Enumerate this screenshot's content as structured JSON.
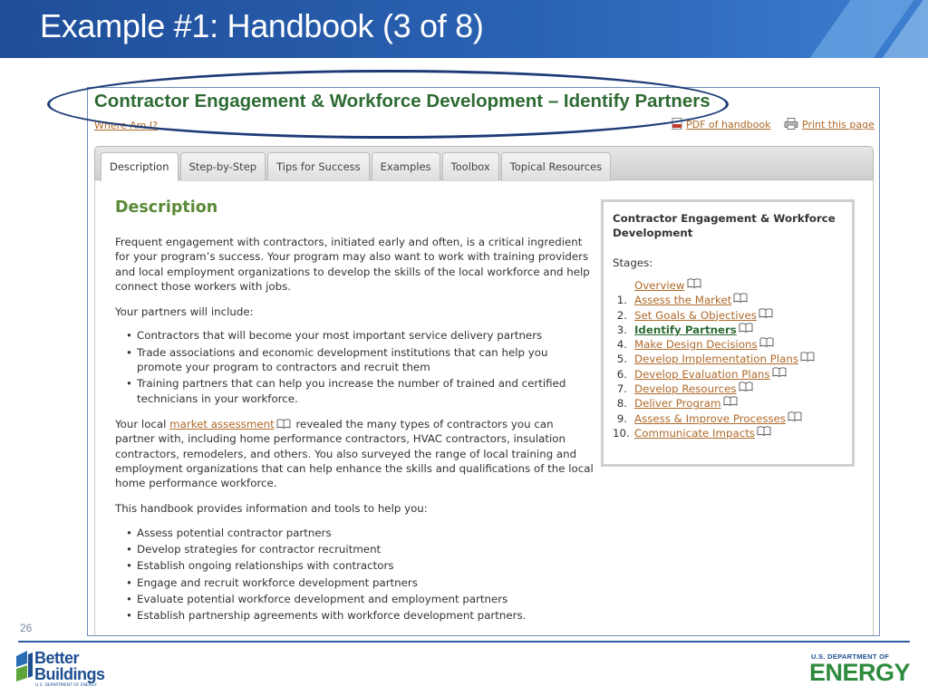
{
  "slide": {
    "title": "Example #1: Handbook (3 of 8)",
    "page_number": "26"
  },
  "page": {
    "heading": "Contractor Engagement & Workforce Development – Identify Partners",
    "where_am_i": "Where Am I?",
    "pdf_link": "PDF of handbook",
    "print_link": "Print this page"
  },
  "tabs": [
    "Description",
    "Step-by-Step",
    "Tips for Success",
    "Examples",
    "Toolbox",
    "Topical Resources"
  ],
  "description": {
    "heading": "Description",
    "para1": "Frequent engagement with contractors, initiated early and often, is a critical ingredient for your program’s success. Your program may also want to work with training providers and local employment organizations to develop the skills of the local workforce and help connect those workers with jobs.",
    "partners_intro": "Your partners will include:",
    "partners": [
      "Contractors that will become your most important service delivery partners",
      "Trade associations and economic development institutions that can help you promote your program to contractors and recruit them",
      "Training partners that can help you increase the number of trained and certified technicians in your workforce."
    ],
    "para2_before": "Your local",
    "para2_link": "market assessment",
    "para2_after": "revealed the many types of contractors you can partner with, including home performance contractors, HVAC contractors, insulation contractors, remodelers, and others. You also surveyed the range of local training and employment organizations that can help enhance the skills and qualifications of the local home performance workforce.",
    "tools_intro": "This handbook provides information and tools to help you:",
    "tools": [
      "Assess potential contractor partners",
      "Develop strategies for contractor recruitment",
      "Establish ongoing relationships with contractors",
      "Engage and recruit workforce development partners",
      "Evaluate potential workforce development and employment partners",
      "Establish partnership agreements with workforce development partners."
    ]
  },
  "stages": {
    "title": "Contractor Engagement & Workforce Development",
    "label": "Stages:",
    "overview": "Overview",
    "items": [
      {
        "num": "1.",
        "label": "Assess the Market"
      },
      {
        "num": "2.",
        "label": "Set Goals & Objectives"
      },
      {
        "num": "3.",
        "label": "Identify Partners"
      },
      {
        "num": "4.",
        "label": "Make Design Decisions"
      },
      {
        "num": "5.",
        "label": "Develop Implementation Plans"
      },
      {
        "num": "6.",
        "label": "Develop Evaluation Plans"
      },
      {
        "num": "7.",
        "label": "Develop Resources"
      },
      {
        "num": "8.",
        "label": "Deliver Program"
      },
      {
        "num": "9.",
        "label": "Assess & Improve Processes"
      },
      {
        "num": "10.",
        "label": "Communicate Impacts"
      }
    ]
  },
  "footer": {
    "bb_line1": "Better",
    "bb_line2": "Buildings",
    "bb_sub": "U.S. DEPARTMENT OF ENERGY",
    "doe_top": "U.S. DEPARTMENT OF",
    "doe_main": "ENERGY"
  },
  "colors": {
    "banner": "#2b63b4",
    "heading_green": "#2e6b34",
    "link_orange": "#b06a2a",
    "ellipse": "#1e3b78",
    "energy_green": "#2e8b3e"
  }
}
